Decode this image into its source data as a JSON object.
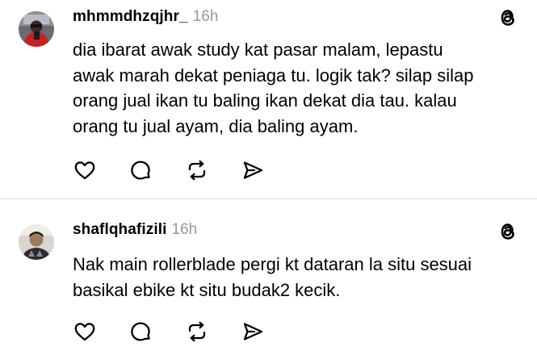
{
  "posts": [
    {
      "username": "mhmmdhzqjhr_",
      "time": "16h",
      "lines": [
        "dia ibarat awak study kat pasar malam, lepastu",
        "awak marah dekat peniaga tu. logik tak? silap silap",
        "orang jual ikan tu baling ikan dekat dia tau. kalau",
        "orang tu jual ayam, dia baling ayam."
      ]
    },
    {
      "username": "shaflqhafizili",
      "time": "16h",
      "lines": [
        "Nak main rollerblade pergi kt dataran la situ sesuai",
        "basikal ebike kt situ budak2 kecik."
      ]
    }
  ],
  "icons": {
    "brand": "threads-icon",
    "like": "heart-icon",
    "reply": "comment-icon",
    "repost": "repost-icon",
    "share": "send-icon"
  },
  "colors": {
    "text": "#000000",
    "timestamp": "#999999",
    "divider": "#dcdcdc"
  }
}
